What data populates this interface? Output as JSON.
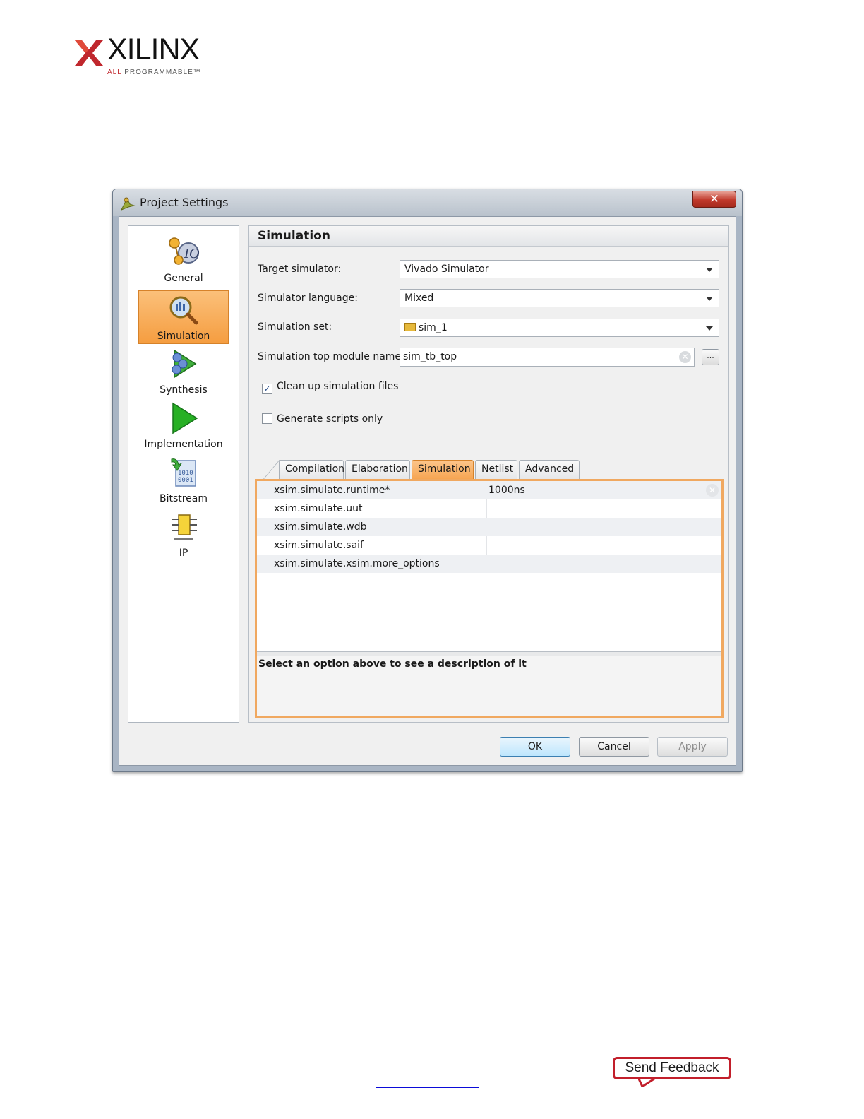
{
  "logo": {
    "word": "XILINX",
    "tag_accent": "ALL",
    "tag_rest": "PROGRAMMABLE",
    "tag_mark": "™",
    "brand_color": "#c0272d"
  },
  "window": {
    "title": "Project Settings",
    "close_glyph": "✕"
  },
  "sidebar": {
    "items": [
      {
        "label": "General",
        "icon": "general-icon"
      },
      {
        "label": "Simulation",
        "icon": "simulation-icon",
        "active": true
      },
      {
        "label": "Synthesis",
        "icon": "synthesis-icon"
      },
      {
        "label": "Implementation",
        "icon": "implementation-icon"
      },
      {
        "label": "Bitstream",
        "icon": "bitstream-icon"
      },
      {
        "label": "IP",
        "icon": "ip-icon"
      }
    ]
  },
  "panel": {
    "title": "Simulation",
    "target_simulator_label": "Target simulator:",
    "target_simulator_value": "Vivado Simulator",
    "simulator_language_label": "Simulator language:",
    "simulator_language_value": "Mixed",
    "simulation_set_label": "Simulation set:",
    "simulation_set_value": "sim_1",
    "top_module_label": "Simulation top module name:",
    "top_module_value": "sim_tb_top",
    "browse_label": "...",
    "clean_up_label": "Clean up simulation files",
    "clean_up_checked": true,
    "scripts_only_label": "Generate scripts only",
    "scripts_only_checked": false,
    "check_glyph": "✓"
  },
  "tabs": [
    {
      "label": "Compilation"
    },
    {
      "label": "Elaboration"
    },
    {
      "label": "Simulation",
      "active": true
    },
    {
      "label": "Netlist"
    },
    {
      "label": "Advanced"
    }
  ],
  "options": {
    "rows": [
      {
        "name": "xsim.simulate.runtime*",
        "value": "1000ns"
      },
      {
        "name": "xsim.simulate.uut",
        "value": ""
      },
      {
        "name": "xsim.simulate.wdb",
        "value": ""
      },
      {
        "name": "xsim.simulate.saif",
        "value": ""
      },
      {
        "name": "xsim.simulate.xsim.more_options",
        "value": ""
      }
    ],
    "description": "Select an option above to see a description of it"
  },
  "buttons": {
    "ok": "OK",
    "cancel": "Cancel",
    "apply": "Apply"
  },
  "footer": {
    "feedback": "Send Feedback",
    "accent_color": "#c21f2b"
  }
}
